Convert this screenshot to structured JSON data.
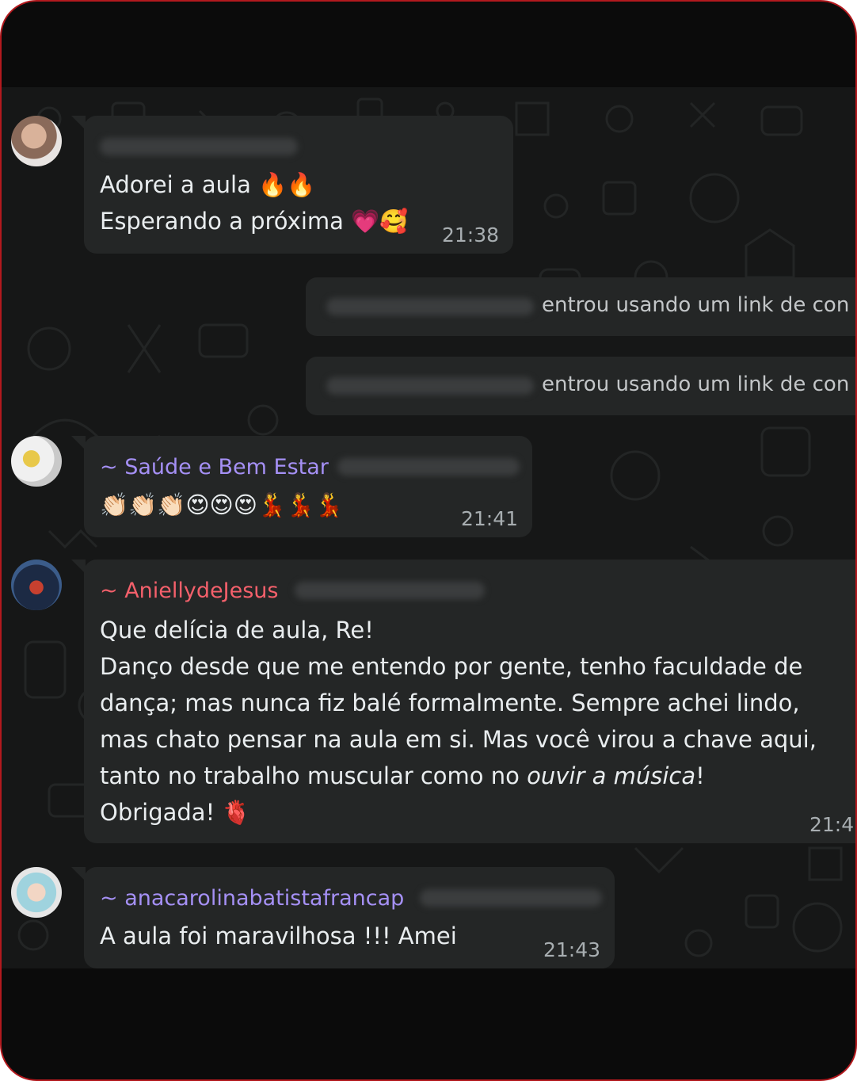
{
  "messages": [
    {
      "text_line1": "Adorei a aula 🔥🔥",
      "text_line2": "Esperando a próxima 💗🥰",
      "time": "21:38"
    },
    {
      "sender": "~ Saúde e Bem Estar",
      "text": "👏🏻👏🏻👏🏻😍😍😍💃💃💃",
      "time": "21:41"
    },
    {
      "sender": "~ AniellydeJesus",
      "lines": [
        "Que delícia de aula, Re!",
        "Danço desde que me entendo por gente, tenho faculdade de",
        "dança; mas nunca fiz balé formalmente. Sempre achei lindo,",
        "mas chato pensar na aula em si. Mas você virou a chave aqui,",
        "tanto no trabalho muscular como no "
      ],
      "italic": "ouvir a música",
      "after_italic": "!",
      "last_line": "Obrigada! 🫀",
      "time": "21:4"
    },
    {
      "sender": "~ anacarolinabatistafrancap",
      "text": "A aula foi maravilhosa !!! Amei",
      "time": "21:43"
    }
  ],
  "system": [
    {
      "text": "entrou usando um link de con"
    },
    {
      "text": "entrou usando um link de con"
    }
  ],
  "colors": {
    "sender_purple": "#a590f5",
    "sender_red": "#f4606b",
    "bubble": "#242626",
    "background": "#161717"
  }
}
